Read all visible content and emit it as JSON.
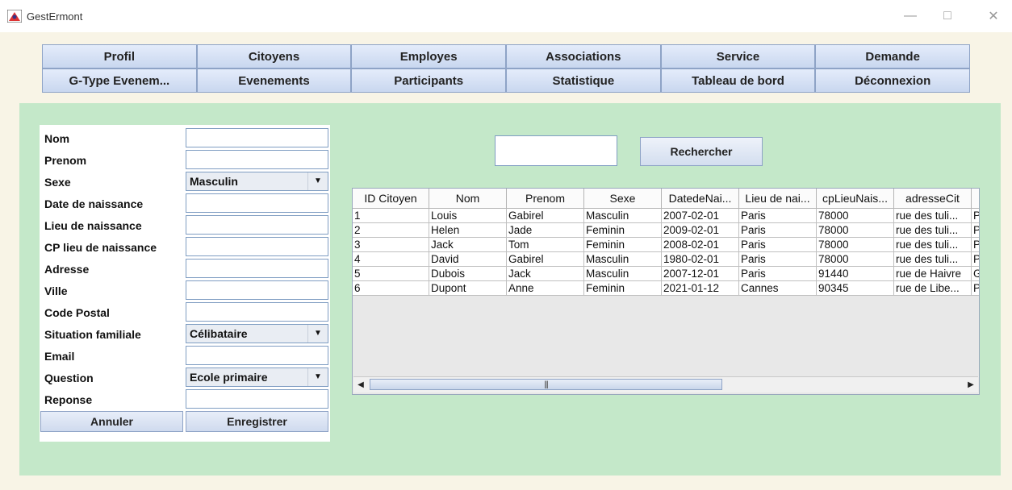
{
  "window": {
    "title": "GestErmont",
    "minimize_icon": "minimize-icon",
    "maximize_icon": "maximize-icon",
    "close_icon": "close-icon"
  },
  "nav": {
    "row1": [
      "Profil",
      "Citoyens",
      "Employes",
      "Associations",
      "Service",
      "Demande"
    ],
    "row2": [
      "G-Type Evenem...",
      "Evenements",
      "Participants",
      "Statistique",
      "Tableau de bord",
      "Déconnexion"
    ]
  },
  "form": {
    "labels": {
      "nom": "Nom",
      "prenom": "Prenom",
      "sexe": "Sexe",
      "date_naissance": "Date de naissance",
      "lieu_naissance": "Lieu de naissance",
      "cp_lieu_naissance": "CP lieu de naissance",
      "adresse": "Adresse",
      "ville": "Ville",
      "code_postal": "Code Postal",
      "situation_familiale": "Situation familiale",
      "email": "Email",
      "question": "Question",
      "reponse": "Reponse"
    },
    "sexe_value": "Masculin",
    "situation_value": "Célibataire",
    "question_value": "Ecole primaire",
    "annuler_label": "Annuler",
    "enregistrer_label": "Enregistrer"
  },
  "search": {
    "button_label": "Rechercher",
    "value": ""
  },
  "table": {
    "columns": [
      "ID Citoyen",
      "Nom",
      "Prenom",
      "Sexe",
      "DatedeNai...",
      "Lieu de nai...",
      "cpLieuNais...",
      "adresseCit",
      ""
    ],
    "rows": [
      [
        "1",
        "Louis",
        "Gabirel",
        "Masculin",
        "2007-02-01",
        "Paris",
        "78000",
        "rue des tuli...",
        "P"
      ],
      [
        "2",
        "Helen",
        "Jade",
        "Feminin",
        "2009-02-01",
        "Paris",
        "78000",
        "rue des tuli...",
        "P"
      ],
      [
        "3",
        "Jack",
        "Tom",
        "Feminin",
        "2008-02-01",
        "Paris",
        "78000",
        "rue des tuli...",
        "P"
      ],
      [
        "4",
        "David",
        "Gabirel",
        "Masculin",
        "1980-02-01",
        "Paris",
        "78000",
        "rue des tuli...",
        "P"
      ],
      [
        "5",
        "Dubois",
        "Jack",
        "Masculin",
        "2007-12-01",
        "Paris",
        "91440",
        "rue de Haivre",
        "G"
      ],
      [
        "6",
        "Dupont",
        "Anne",
        "Feminin",
        "2021-01-12",
        "Cannes",
        "90345",
        "rue de Libe...",
        "P"
      ]
    ]
  },
  "colors": {
    "panel": "#c4e8c9",
    "background": "#f8f4e6",
    "nav_button": "#d6e1f4",
    "border": "#8ea3c6"
  }
}
